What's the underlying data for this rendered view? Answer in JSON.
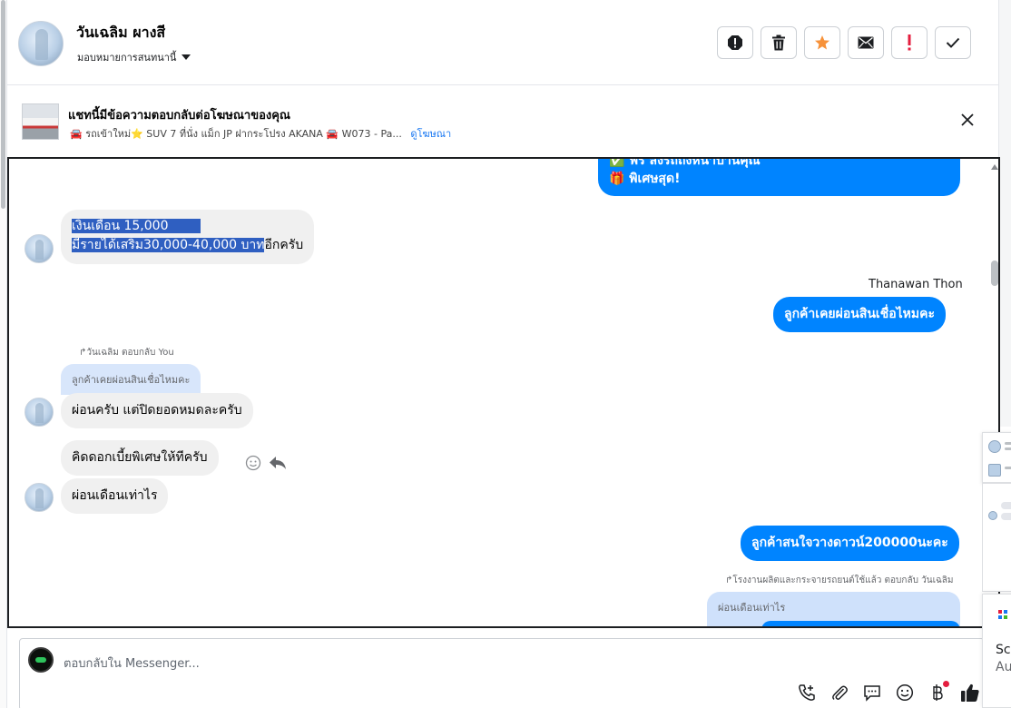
{
  "header": {
    "contact_name": "วันเฉลิม ผางสี",
    "assign_label": "มอบหมายการสนทนานี้",
    "colors": {
      "star": "#f7923a",
      "important": "#e41e3f"
    },
    "actions": [
      {
        "name": "spam-icon"
      },
      {
        "name": "trash-icon"
      },
      {
        "name": "star-icon"
      },
      {
        "name": "mail-icon"
      },
      {
        "name": "important-icon"
      },
      {
        "name": "check-icon"
      }
    ]
  },
  "ad": {
    "title": "แชทนี้มีข้อความตอบกลับต่อโฆษณาของคุณ",
    "subtitle": "🚘 รถเข้าใหม่⭐ SUV 7 ที่นั่ง แม็ก JP ฝากระโปรง AKANA 🚘 W073 - Pa...",
    "link_label": "ดูโฆษณา"
  },
  "messages": {
    "top_out_line1": "✅ ฟรี ส่งรถถึงหน้าบ้านคุณ",
    "top_out_line2": "🎁 พิเศษสุด!",
    "salary_line1": "เงินเดือน 15,000",
    "salary_line2_selected": "มีรายได้เสริม30,000-40,000 บาท",
    "salary_line2_rest": "อีกครับ",
    "agent_name": "Thanawan Thon",
    "agent_question": "ลูกค้าเคยผ่อนสินเชื่อไหมคะ",
    "reply_meta": "วันเฉลิม ตอบกลับ You",
    "reply_quote": "ลูกค้าเคยผ่อนสินเชื่อไหมคะ",
    "reply_text": "ผ่อนครับ แต่ปิดยอดหมดละครับ",
    "interest_msg": "คิดดอกเบี้ยพิเศษให้ทีครับ",
    "monthly_msg": "ผ่อนเดือนเท่าไร",
    "downpayment_msg": "ลูกค้าสนใจวางดาวน์200000นะคะ",
    "page_reply_meta": "โรงงานผลิตและกระจายรถยนต์ใช้แล้ว ตอบกลับ วันเฉลิม",
    "page_reply_quote": "ผ่อนเดือนเท่าไร"
  },
  "composer": {
    "placeholder": "ตอบกลับใน Messenger...",
    "tools": [
      "call-add-icon",
      "attach-icon",
      "saved-reply-icon",
      "emoji-icon",
      "baht-icon",
      "like-icon"
    ],
    "like_color": "#1c1e21"
  },
  "side_popup": {
    "text_line1": "Scr",
    "text_line2": "Au"
  }
}
